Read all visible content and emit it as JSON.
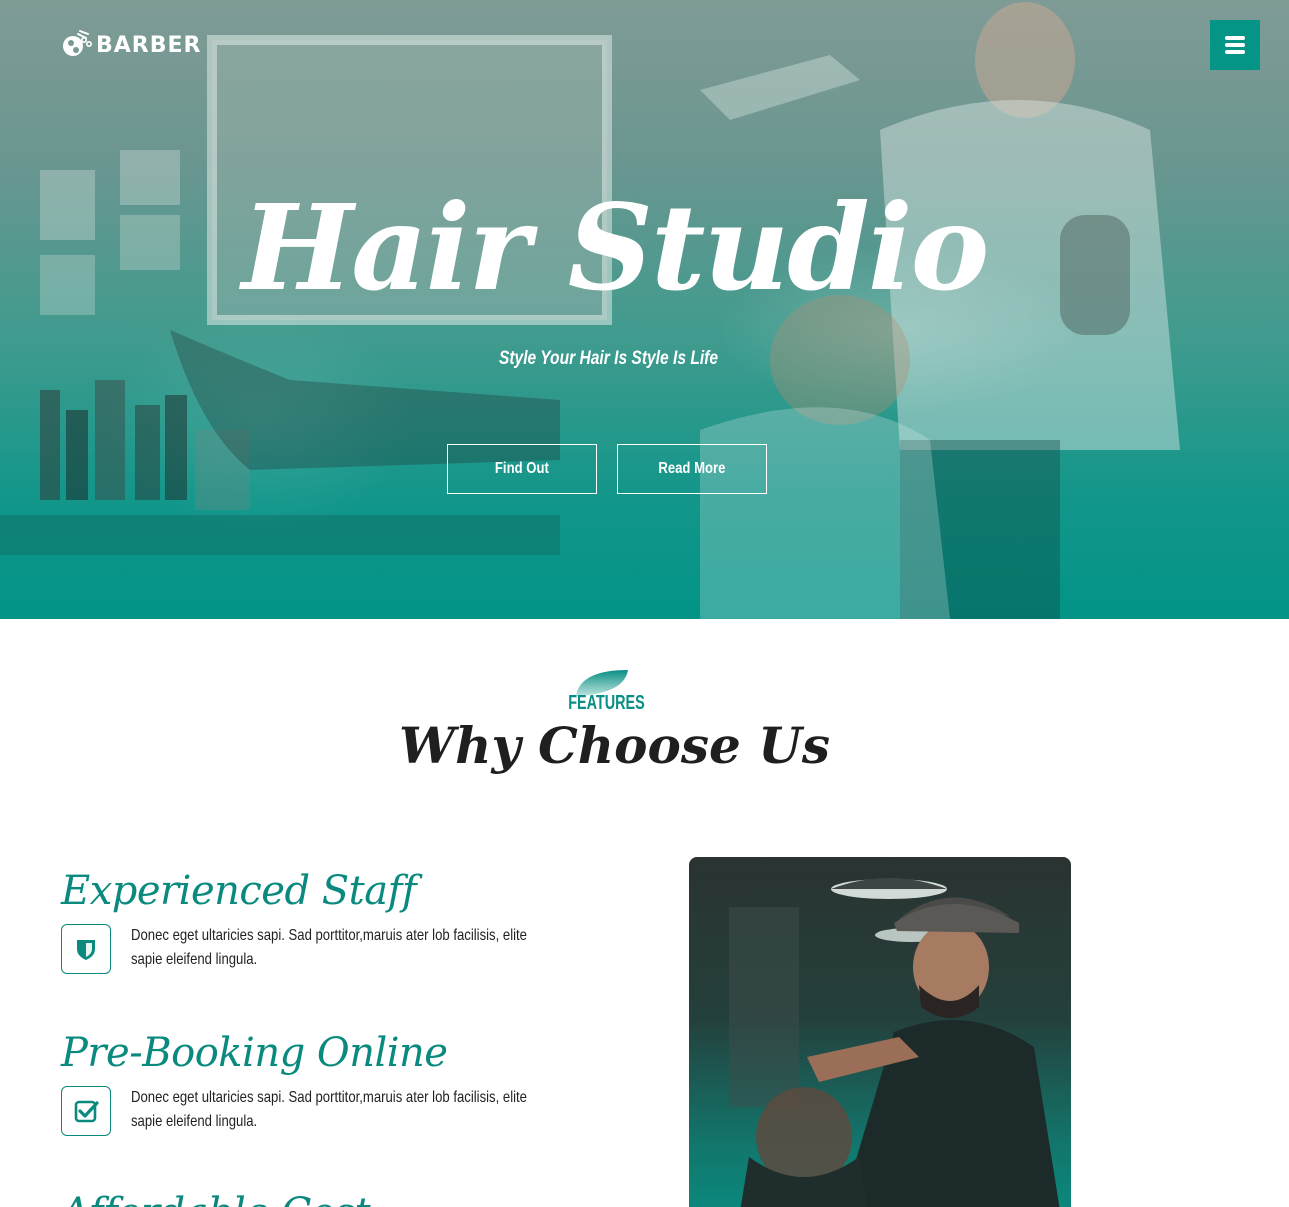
{
  "brand": {
    "name": "BARBER",
    "logo_icon": "scissors-logo-icon"
  },
  "header": {
    "menu_icon": "hamburger-menu-icon",
    "menu_button_color": "#059587"
  },
  "hero": {
    "title": "Hair Studio",
    "subtitle": "Style Your Hair Is Style Is Life",
    "buttons": [
      {
        "label": "Find Out"
      },
      {
        "label": "Read More"
      }
    ],
    "overlay_color": "#029487"
  },
  "features": {
    "eyebrow": "FEATURES",
    "title": "Why Choose Us",
    "items": [
      {
        "title": "Experienced Staff",
        "icon": "shield-icon",
        "text": "Donec eget ultaricies sapi. Sad porttitor,maruis ater lob facilisis, elite sapie eleifend lingula."
      },
      {
        "title": "Pre-Booking Online",
        "icon": "checkbox-icon",
        "text": "Donec eget ultaricies sapi. Sad porttitor,maruis ater lob facilisis, elite sapie eleifend lingula."
      },
      {
        "title": "Affordable Cost",
        "icon": "tag-icon",
        "text": ""
      }
    ],
    "accent_color": "#0a8a7f"
  }
}
